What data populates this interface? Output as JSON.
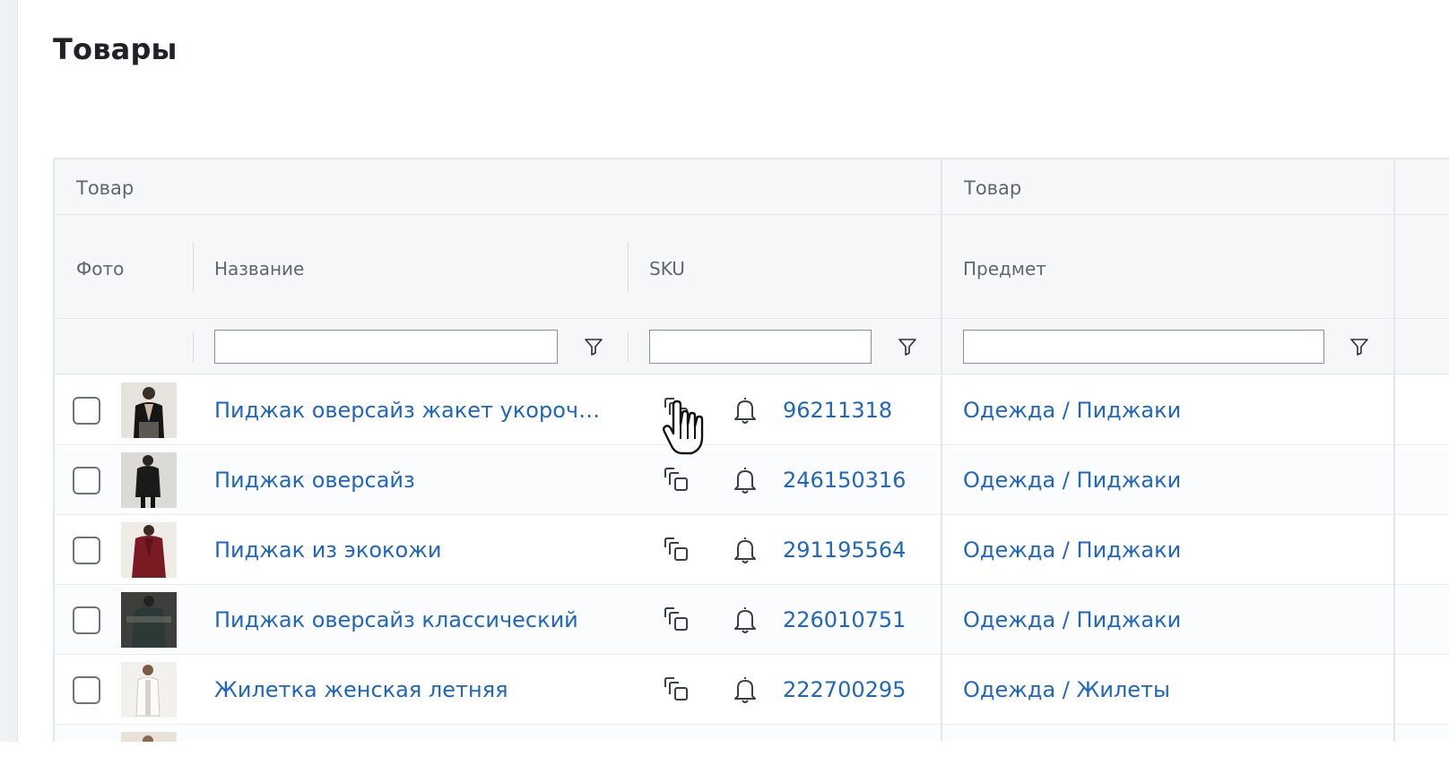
{
  "page": {
    "title": "Товары"
  },
  "table": {
    "groups": [
      "Товар",
      "Товар"
    ],
    "columns": {
      "photo": "Фото",
      "name": "Название",
      "sku": "SKU",
      "subject": "Предмет"
    },
    "rows": [
      {
        "name": "Пиджак оверсайз жакет укороче...",
        "sku": "96211318",
        "subject": "Одежда / Пиджаки"
      },
      {
        "name": "Пиджак оверсайз",
        "sku": "246150316",
        "subject": "Одежда / Пиджаки"
      },
      {
        "name": "Пиджак из экокожи",
        "sku": "291195564",
        "subject": "Одежда / Пиджаки"
      },
      {
        "name": "Пиджак оверсайз классический",
        "sku": "226010751",
        "subject": "Одежда / Пиджаки"
      },
      {
        "name": "Жилетка женская летняя",
        "sku": "222700295",
        "subject": "Одежда / Жилеты"
      }
    ]
  },
  "icons": {
    "filter": "filter-funnel-icon",
    "copy": "copy-icon",
    "bell": "bell-icon",
    "cursor": "hand-pointer-cursor"
  },
  "colors": {
    "link": "#1f66c1",
    "header_bg": "#f6f7f9",
    "border": "#e3e6ea"
  }
}
